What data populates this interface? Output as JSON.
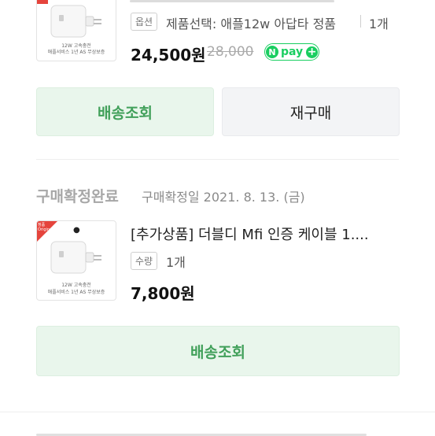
{
  "order1": {
    "option_tag": "옵션",
    "option_text": "제품선택: 애플12w 아답타 정품",
    "qty": "1개",
    "price": "24,500원",
    "original_price": "28,000",
    "npay_label": "pay",
    "thumb_caption1": "12W 고속충전",
    "thumb_caption2": "애플서비스 1년 AS 무상보증",
    "btn_tracking": "배송조회",
    "btn_reorder": "재구매"
  },
  "order2": {
    "status": "구매확정완료",
    "confirm_date": "구매확정일 2021. 8. 13. (금)",
    "title": "[추가상품] 더블디 Mfi 인증 케이블 1....",
    "qty_tag": "수량",
    "qty": "1개",
    "price": "7,800원",
    "thumb_badge": "정품\nOriginal",
    "thumb_caption1": "12W 고속충전",
    "thumb_caption2": "애플서비스 1년 AS 무상보증",
    "btn_tracking": "배송조회"
  },
  "colors": {
    "accent_green": "#41a05a",
    "button_green_bg": "#e9f6ec",
    "npay_green": "#19ce60",
    "badge_red": "#e5443c"
  }
}
